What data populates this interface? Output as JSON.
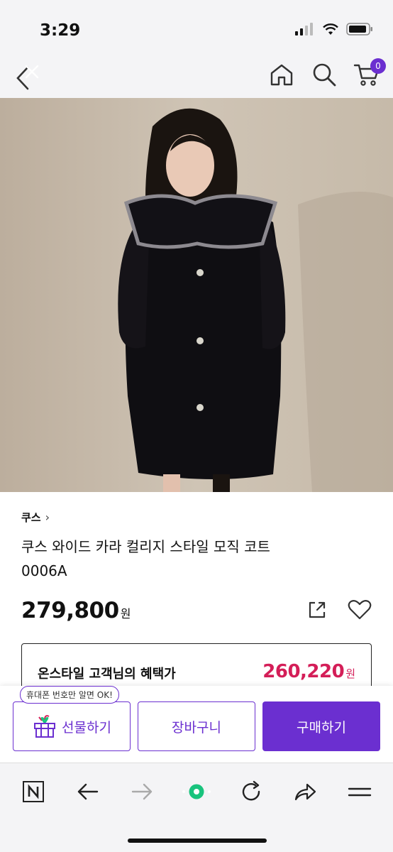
{
  "status_bar": {
    "time": "3:29"
  },
  "nav": {
    "cart_count": "0"
  },
  "product": {
    "brand": "쿠스",
    "brand_chevron": "›",
    "name_line1": "쿠스 와이드 카라 컬리지 스타일 모직 코트",
    "name_line2": "0006A",
    "price": "279,800",
    "price_unit": "원"
  },
  "benefit": {
    "label": "온스타일 고객님의 혜택가",
    "price": "260,220",
    "price_unit": "원"
  },
  "actions": {
    "gift_tooltip": "휴대폰 번호만 알면 OK!",
    "gift_label": "선물하기",
    "cart_label": "장바구니",
    "buy_label": "구매하기"
  },
  "browser": {
    "icons": [
      "naver-icon",
      "back-arrow-icon",
      "forward-arrow-icon",
      "green-dot-icon",
      "refresh-icon",
      "share-icon",
      "menu-icon"
    ]
  },
  "colors": {
    "brand": "#6b2fd0",
    "benefit_price": "#d41e58",
    "green_dot": "#19c37d"
  }
}
